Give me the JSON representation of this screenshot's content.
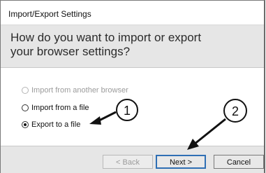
{
  "window": {
    "title": "Import/Export Settings"
  },
  "header": {
    "question": "How do you want to import or export your browser settings?"
  },
  "options": [
    {
      "label": "Import from another browser",
      "state": "disabled"
    },
    {
      "label": "Import from a file",
      "state": "unchecked"
    },
    {
      "label": "Export to a file",
      "state": "checked"
    }
  ],
  "buttons": {
    "back": "< Back",
    "next": "Next >",
    "cancel": "Cancel"
  },
  "callouts": {
    "one": "1",
    "two": "2"
  },
  "colors": {
    "header_bg": "#e6e6e6",
    "footer_bg": "#e6e6e6",
    "next_button_border": "#2f6fb4",
    "disabled_text": "#9b9b9b"
  }
}
